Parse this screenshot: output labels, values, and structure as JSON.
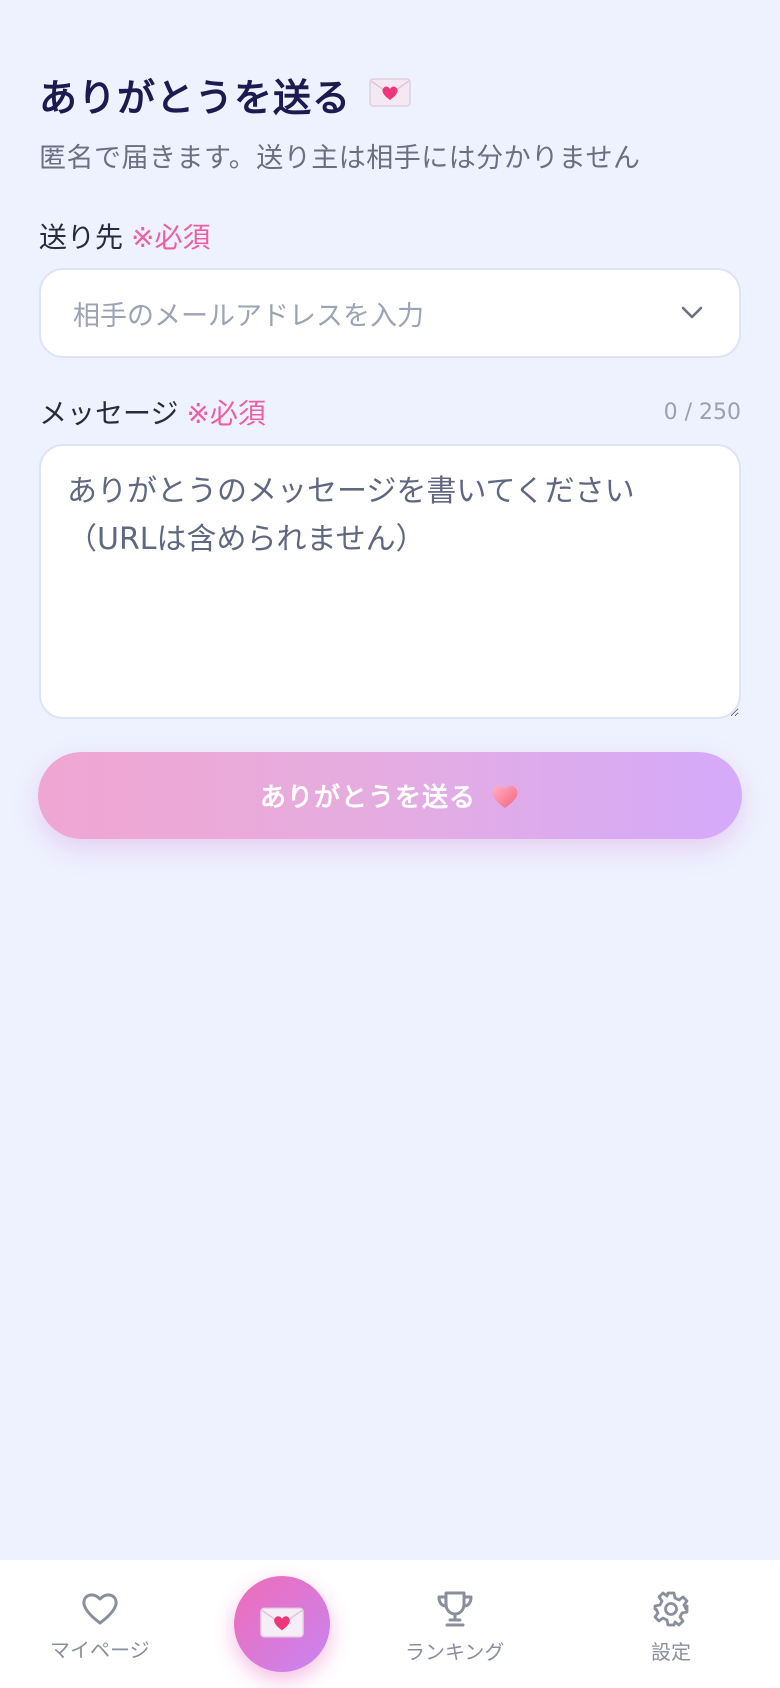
{
  "header": {
    "title": "ありがとうを送る",
    "title_icon": "love-letter-icon",
    "subtitle": "匿名で届きます。送り主は相手には分かりません"
  },
  "recipient": {
    "label": "送り先",
    "required": "※必須",
    "placeholder": "相手のメールアドレスを入力"
  },
  "message": {
    "label": "メッセージ",
    "required": "※必須",
    "counter": "0 / 250",
    "placeholder": "ありがとうのメッセージを書いてください（URLは含められません）"
  },
  "send_button": {
    "label": "ありがとうを送る",
    "icon": "heart-icon"
  },
  "nav": {
    "mypage": "マイページ",
    "ranking": "ランキング",
    "settings": "設定",
    "center_icon": "love-letter-icon"
  },
  "colors": {
    "background": "#eef1fe",
    "accent_pink": "#ec5fa6",
    "accent_purple": "#c884f3",
    "title": "#1d1a4f"
  }
}
